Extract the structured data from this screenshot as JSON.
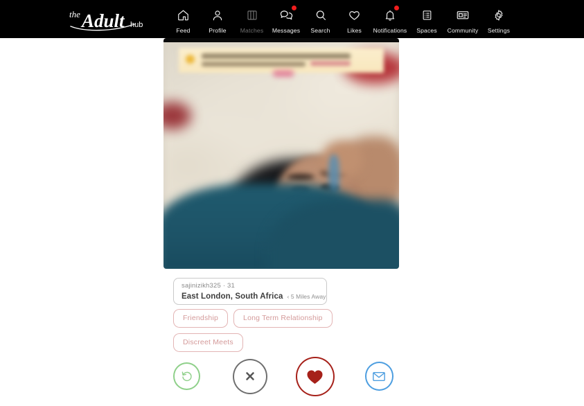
{
  "header": {
    "logo": {
      "name": "the-adult-hub-logo",
      "text_the": "the",
      "text_main": "Adult",
      "text_hub": "hub"
    },
    "nav": [
      {
        "id": "feed",
        "label": "Feed",
        "icon": "home-icon",
        "badge": false,
        "dim": false
      },
      {
        "id": "profile",
        "label": "Profile",
        "icon": "person-icon",
        "badge": false,
        "dim": false
      },
      {
        "id": "matches",
        "label": "Matches",
        "icon": "cards-icon",
        "badge": false,
        "dim": true
      },
      {
        "id": "messages",
        "label": "Messages",
        "icon": "chat-bubbles-icon",
        "badge": true,
        "dim": false
      },
      {
        "id": "search",
        "label": "Search",
        "icon": "search-icon",
        "badge": false,
        "dim": false
      },
      {
        "id": "likes",
        "label": "Likes",
        "icon": "heart-icon",
        "badge": false,
        "dim": false
      },
      {
        "id": "notifications",
        "label": "Notifications",
        "icon": "bell-icon",
        "badge": true,
        "dim": false
      },
      {
        "id": "spaces",
        "label": "Spaces",
        "icon": "list-document-icon",
        "badge": false,
        "dim": false
      },
      {
        "id": "community",
        "label": "Community",
        "icon": "news-card-icon",
        "badge": false,
        "dim": false
      },
      {
        "id": "settings",
        "label": "Settings",
        "icon": "gear-icon",
        "badge": false,
        "dim": false
      }
    ]
  },
  "profile_card": {
    "photo": {
      "name": "profile-photo",
      "state": "blurred",
      "description": "blurred selfie"
    },
    "username_age": "sajinizikh325 · 31",
    "location": "East London, South Africa",
    "distance": "‹ 5 Miles Away",
    "tags": [
      "Friendship",
      "Long Term Relationship",
      "Discreet Meets"
    ]
  },
  "actions": [
    {
      "id": "undo",
      "icon": "rewind-icon",
      "color": "#8fd08a",
      "label": "Undo"
    },
    {
      "id": "pass",
      "icon": "close-x-icon",
      "color": "#6f6f6f",
      "label": "Pass"
    },
    {
      "id": "like",
      "icon": "heart-icon",
      "color": "#a6211a",
      "label": "Like"
    },
    {
      "id": "message",
      "icon": "envelope-icon",
      "color": "#4d9ee0",
      "label": "Message"
    }
  ],
  "colors": {
    "header_bg": "#000000",
    "page_bg": "#ffffff",
    "badge": "#f01d1d",
    "tag_border": "#e3b4b4",
    "tag_text": "#d49a9a",
    "like": "#a6211a",
    "message": "#4d9ee0",
    "undo": "#8fd08a",
    "pass": "#6f6f6f"
  }
}
